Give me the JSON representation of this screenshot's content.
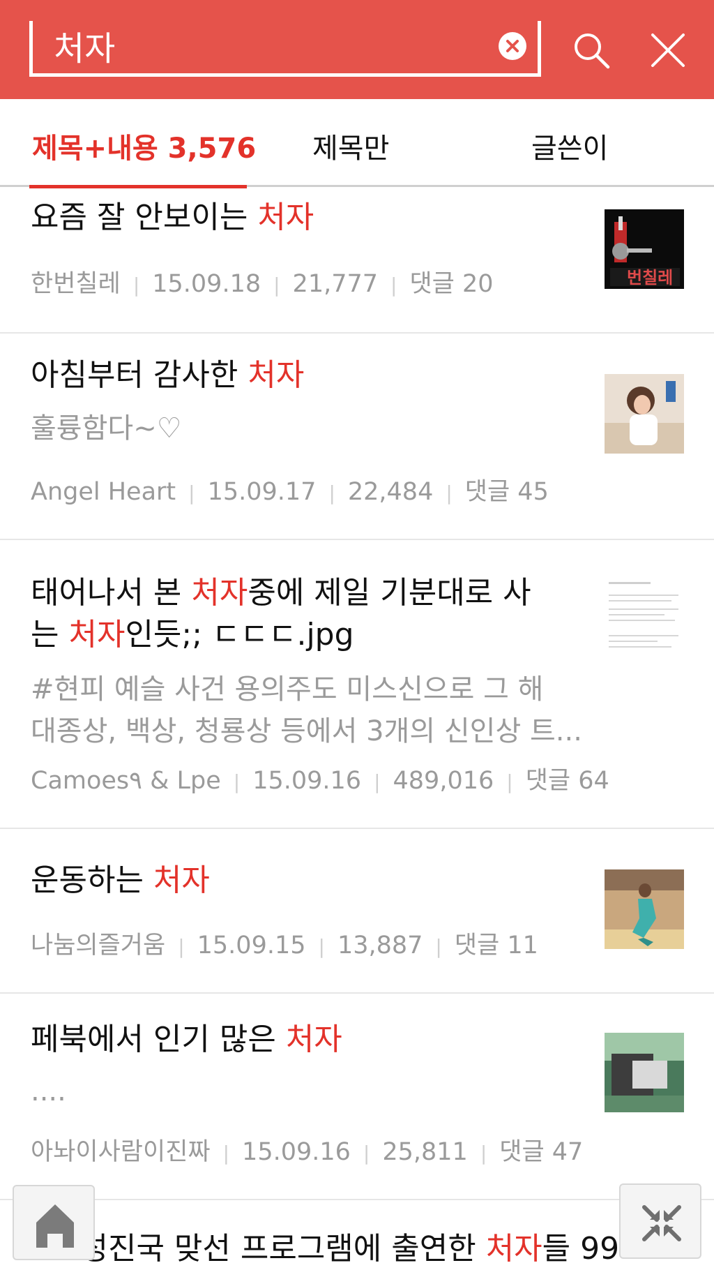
{
  "search": {
    "query": "처자"
  },
  "tabs": [
    {
      "label": "제목+내용 3,576"
    },
    {
      "label": "제목만"
    },
    {
      "label": "글쓴이"
    }
  ],
  "results": [
    {
      "title_pre": "요즘 잘 안보이는 ",
      "title_hl": "처자",
      "title_post": "",
      "author": "한번칠레",
      "date": "15.09.18",
      "views": "21,777",
      "comments": "댓글 20",
      "thumb_text": "번칠레"
    },
    {
      "title_pre": "아침부터 감사한 ",
      "title_hl": "처자",
      "title_post": "",
      "snippet": "훌륭함다~♡",
      "author": "Angel Heart",
      "date": "15.09.17",
      "views": "22,484",
      "comments": "댓글 45"
    },
    {
      "title_line1_pre": "태어나서 본 ",
      "title_line1_hl": "처자",
      "title_line1_post": "중에 제일 기분대로 사",
      "title_line2_pre": "는 ",
      "title_line2_hl": "처자",
      "title_line2_post": "인듯;; ㄷㄷㄷ.jpg",
      "snippet_line1": "#현피 예슬 사건 용의주도 미스신으로 그 해",
      "snippet_line2": "대종상, 백상, 청룡상 등에서 3개의 신인상 트...",
      "author": "Camoes٩ & Lpe",
      "date": "15.09.16",
      "views": "489,016",
      "comments": "댓글 64"
    },
    {
      "title_pre": "운동하는 ",
      "title_hl": "처자",
      "title_post": "",
      "author": "나눔의즐거움",
      "date": "15.09.15",
      "views": "13,887",
      "comments": "댓글 11"
    },
    {
      "title_pre": "페북에서 인기 많은 ",
      "title_hl": "처자",
      "title_post": "",
      "snippet": "....",
      "author": "아놔이사람이진짜",
      "date": "15.09.16",
      "views": "25,811",
      "comments": "댓글 47"
    },
    {
      "title_pre": "Re:성진국 맞선 프로그램에 출연한 ",
      "title_hl": "처자",
      "title_post": "들 99"
    }
  ],
  "colors": {
    "header": "#e5534b",
    "accent": "#e3322a",
    "meta": "#9a9a9a"
  },
  "icons": [
    "clear-icon",
    "search-icon",
    "close-icon",
    "home-icon",
    "collapse-icon"
  ]
}
